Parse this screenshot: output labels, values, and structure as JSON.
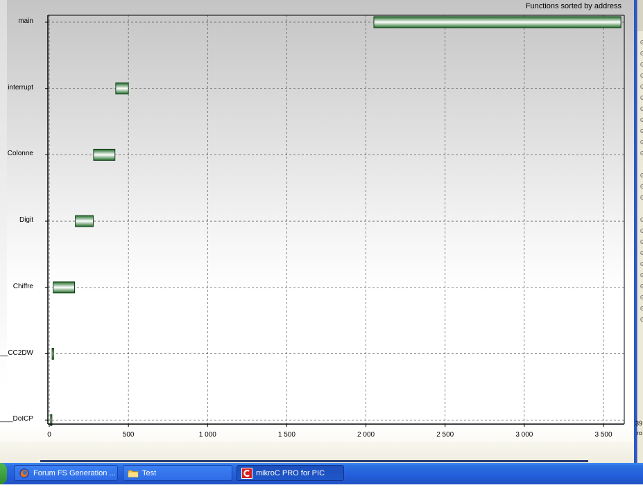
{
  "chart_data": {
    "type": "bar",
    "orientation": "horizontal",
    "title": "Functions sorted by address",
    "xlim": [
      0,
      3650
    ],
    "x_ticks": [
      0,
      500,
      1000,
      1500,
      2000,
      2500,
      3000,
      3500
    ],
    "x_tick_labels": [
      "0",
      "500",
      "1 000",
      "1 500",
      "2 000",
      "2 500",
      "3 000",
      "3 500"
    ],
    "grid": true,
    "categories": [
      "main",
      "interrupt",
      "Colonne",
      "Digit",
      "Chiffre",
      "__CC2DW",
      "____DoICP"
    ],
    "bars": [
      {
        "name": "main",
        "start": 2050,
        "end": 3610
      },
      {
        "name": "interrupt",
        "start": 420,
        "end": 500
      },
      {
        "name": "Colonne",
        "start": 280,
        "end": 415
      },
      {
        "name": "Digit",
        "start": 165,
        "end": 278
      },
      {
        "name": "Chiffre",
        "start": 25,
        "end": 160
      },
      {
        "name": "__CC2DW",
        "start": 18,
        "end": 28
      },
      {
        "name": "____DoICP",
        "start": 8,
        "end": 16
      }
    ],
    "bar_color": "#2e8b3a"
  },
  "taskbar": {
    "buttons": [
      {
        "label": "Forum FS Generation ...",
        "icon": "firefox-icon"
      },
      {
        "label": "Test",
        "icon": "folder-icon"
      },
      {
        "label": "mikroC PRO for PIC",
        "icon": "mikroc-icon"
      }
    ]
  },
  "right_panel": {
    "text1": "39",
    "text2": "ro"
  }
}
